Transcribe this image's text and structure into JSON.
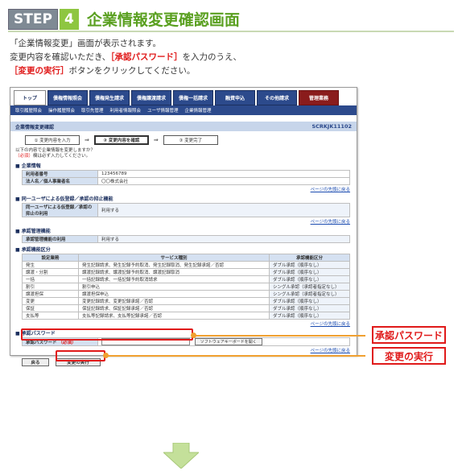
{
  "header": {
    "step_label": "STEP",
    "step_number": "4",
    "title": "企業情報変更確認画面"
  },
  "description": {
    "line1": "「企業情報変更」画面が表示されます。",
    "line2_a": "変更内容を確認いただき、",
    "line2_hl": "［承認パスワード］",
    "line2_b": "を入力のうえ、",
    "line3_hl": "［変更の実行］",
    "line3_b": "ボタンをクリックしてください。"
  },
  "screen": {
    "menu": [
      "トップ",
      "債権情報照会",
      "債権発生請求",
      "債権譲渡請求",
      "債権一括請求",
      "融資申込",
      "その他請求",
      "管理業務"
    ],
    "submenu": [
      "取引履歴照会",
      "操作履歴照会",
      "取引先管理",
      "利用者情報照会",
      "ユーザ情報管理",
      "企業情報管理"
    ],
    "page_title": "企業情報変更確認",
    "screen_code": "SCRKJK11102",
    "flow": [
      "① 変更内容を入力",
      "② 変更内容を確認",
      "③ 変更完了"
    ],
    "note_line1": "以下の内容で企業情報を変更しますか？",
    "note_req": "（必須）",
    "note_line2": "欄は必ず入力してください。",
    "company_section": "企業情報",
    "company_rows": [
      {
        "k": "利用者番号",
        "v": "123456789"
      },
      {
        "k": "法人名／個人事業者名",
        "v": "〇〇株式会社"
      }
    ],
    "to_top": "ページの先頭に戻る",
    "same_user_section": "同一ユーザによる仮登録／承認の抑止機能",
    "same_user_row": {
      "k": "同一ユーザによる仮登録／承認の抑止の利用",
      "v": "利用する"
    },
    "approval_mgmt_section": "承認管理機能",
    "approval_mgmt_row": {
      "k": "承認管理機能の利用",
      "v": "利用する"
    },
    "approval_cls_section": "承認機能区分",
    "approval_cls_headers": [
      "設定業務",
      "サービス種別",
      "承認機能区分"
    ],
    "approval_cls_rows": [
      [
        "発生",
        "発生記録請求、発生記録予約取消、発生記録取消、発生記録承諾／否認",
        "ダブル承認（順序なし）"
      ],
      [
        "譲渡・分割",
        "譲渡記録請求、譲渡記録予約取消、譲渡記録取消",
        "ダブル承認（順序なし）"
      ],
      [
        "一括",
        "一括記録請求、一括記録予約取消請求",
        "ダブル承認（順序なし）"
      ],
      [
        "割引",
        "割引申込",
        "シングル承認（承認者指定なし）"
      ],
      [
        "譲渡担保",
        "譲渡担保申込",
        "シングル承認（承認者指定なし）"
      ],
      [
        "変更",
        "変更記録請求、変更記録承諾／否認",
        "ダブル承認（順序なし）"
      ],
      [
        "保証",
        "保証記録請求、保証記録承諾／否認",
        "ダブル承認（順序なし）"
      ],
      [
        "支払等",
        "支払等記録請求、支払等記録承諾／否認",
        "ダブル承認（順序なし）"
      ]
    ],
    "password_section": "承認パスワード",
    "password_label": "承認パスワード",
    "password_req": "（必須）",
    "keyboard_button": "ソフトウェアキーボードを開く",
    "back_button": "戻る",
    "exec_button": "変更の実行"
  },
  "callouts": {
    "password": "承認パスワード",
    "exec": "変更の実行"
  },
  "colors": {
    "accent_green": "#5aa020",
    "highlight_red": "#e01a1a",
    "menu_blue": "#2c4a8c",
    "connector_orange": "#f0a030"
  }
}
